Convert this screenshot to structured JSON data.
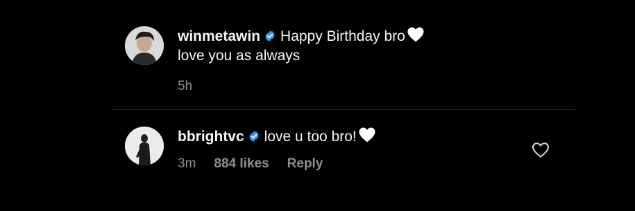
{
  "comments": [
    {
      "username": "winmetawin",
      "text_line1": "Happy Birthday bro",
      "text_line2": "love you as always",
      "time": "5h"
    },
    {
      "username": "bbrightvc",
      "text_line1": "love u too bro!",
      "time": "3m",
      "likes": "884 likes",
      "reply_label": "Reply"
    }
  ],
  "icons": {
    "verified": "verified-badge-icon",
    "emoji": "white-heart-emoji-icon",
    "like": "heart-outline-icon"
  },
  "colors": {
    "background": "#000000",
    "text": "#f5f5f5",
    "secondary_text": "#8e8e8e",
    "verified_badge": "#3897f0",
    "divider": "#262626"
  }
}
